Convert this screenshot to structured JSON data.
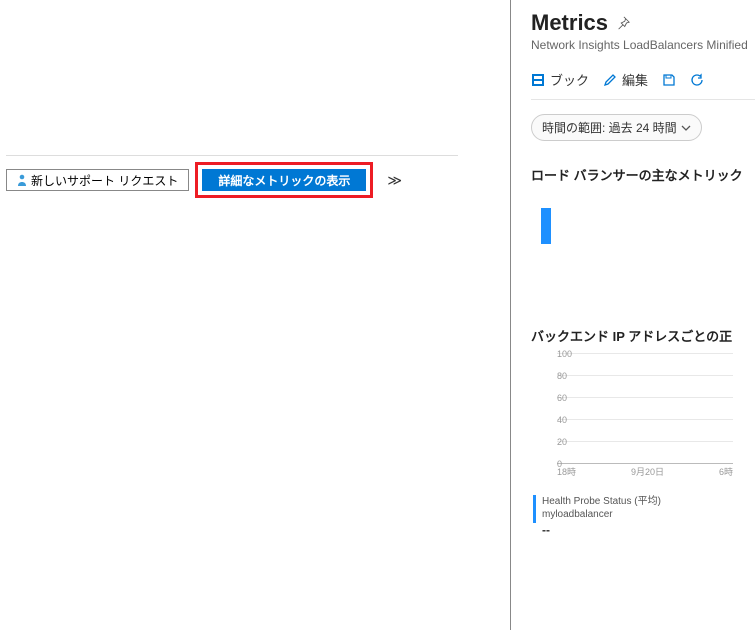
{
  "left": {
    "support_btn_label": "新しいサポート リクエスト",
    "metrics_btn_label": "詳細なメトリックの表示"
  },
  "panel": {
    "title": "Metrics",
    "breadcrumb": "Network Insights LoadBalancers Minified",
    "toolbar": {
      "book": "ブック",
      "edit": "編集"
    },
    "time_range": "時間の範囲: 過去 24 時間",
    "section1_title": "ロード バランサーの主なメトリック",
    "section2_title": "バックエンド IP アドレスごとの正"
  },
  "chart_data": {
    "type": "line",
    "title": "",
    "xlabel": "",
    "ylabel": "",
    "ylim": [
      0,
      100
    ],
    "y_ticks": [
      0,
      20,
      40,
      60,
      80,
      100
    ],
    "x_ticks": [
      "18時",
      "9月20日",
      "6時"
    ],
    "series": [
      {
        "name": "Health Probe Status (平均)",
        "resource": "myloadbalancer",
        "values": [],
        "value_display": "--",
        "color": "#1e90ff"
      }
    ]
  }
}
